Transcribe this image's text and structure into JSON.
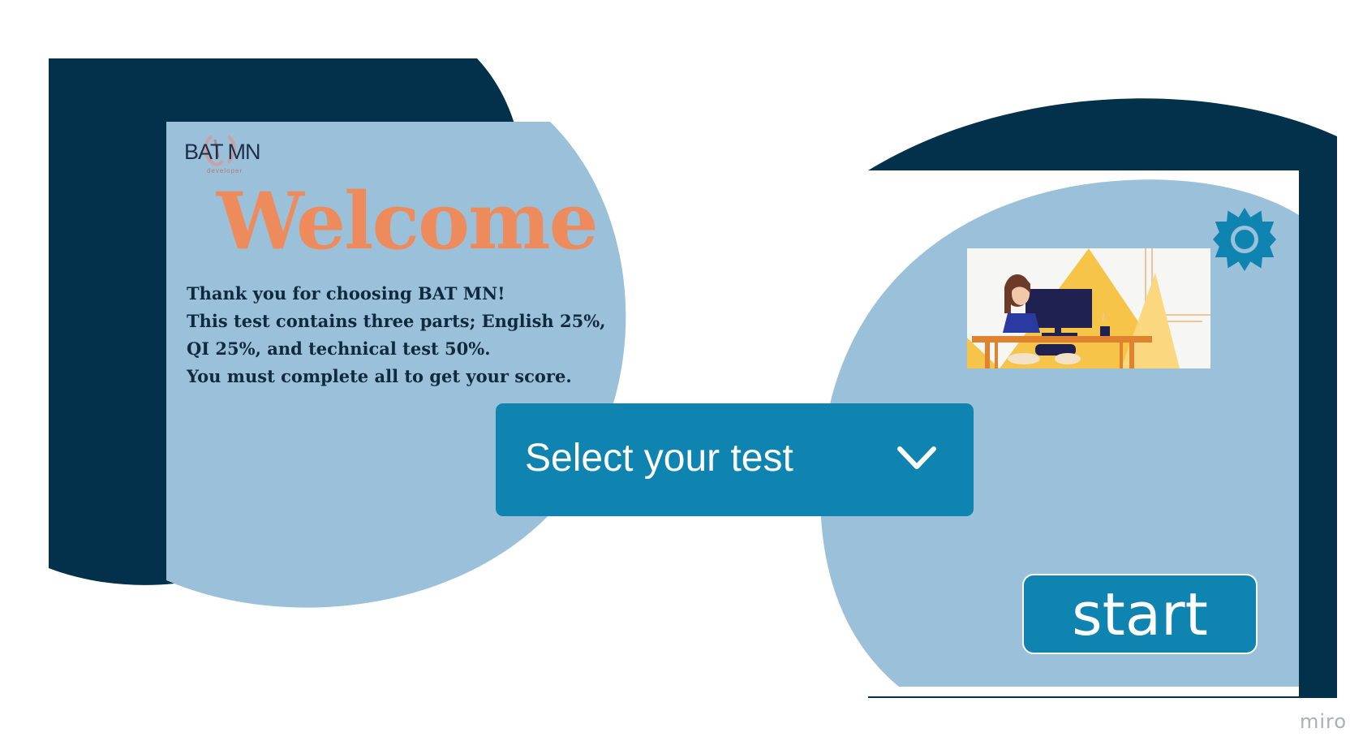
{
  "logo": {
    "text": "BAT MN",
    "subtitle": "developer"
  },
  "welcome_title": "Welcome",
  "intro_lines": [
    "Thank you for choosing BAT MN!",
    "This test contains three parts; English 25%,",
    "QI 25%, and technical test 50%.",
    "You must complete all to get your score."
  ],
  "test_select": {
    "label": "Select your test",
    "icon": "chevron-down-icon"
  },
  "illustration": {
    "icon": "person-at-computer-illustration"
  },
  "settings": {
    "icon": "gear-icon"
  },
  "start_button": {
    "label": "start"
  },
  "watermark": "miro",
  "colors": {
    "navy": "#03304a",
    "light_blue": "#9ac1d9",
    "accent_blue": "#0f84b0",
    "welcome_orange": "#ee8b5c",
    "text_dark": "#0f2a40"
  }
}
